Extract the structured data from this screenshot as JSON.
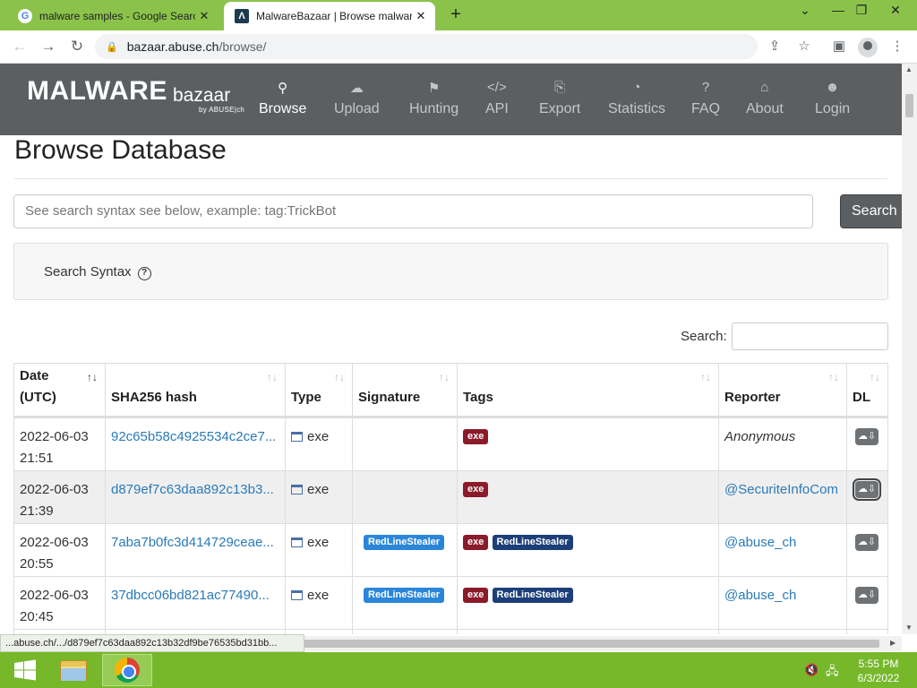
{
  "browser": {
    "tabs": [
      {
        "title": "malware samples - Google Search",
        "favicon": "G",
        "active": false
      },
      {
        "title": "MalwareBazaar | Browse malware",
        "favicon": "Λ",
        "active": true
      }
    ],
    "new_tab": "+",
    "address": {
      "host": "bazaar.abuse.ch",
      "path": "/browse/"
    }
  },
  "site": {
    "logo_main": "MALWARE",
    "logo_sub": "bazaar",
    "logo_by": "by ABUSE|ch",
    "nav": [
      {
        "label": "Browse",
        "icon": "search-icon"
      },
      {
        "label": "Upload",
        "icon": "cloud-upload-icon"
      },
      {
        "label": "Hunting",
        "icon": "hunting-icon"
      },
      {
        "label": "API",
        "icon": "code-icon"
      },
      {
        "label": "Export",
        "icon": "export-icon"
      },
      {
        "label": "Statistics",
        "icon": "pie-chart-icon"
      },
      {
        "label": "FAQ",
        "icon": "question-icon"
      },
      {
        "label": "About",
        "icon": "building-icon"
      },
      {
        "label": "Login",
        "icon": "user-icon"
      }
    ]
  },
  "page": {
    "title": "Browse Database",
    "search_placeholder": "See search syntax see below, example: tag:TrickBot",
    "search_button": "Search",
    "syntax_label": "Search Syntax",
    "filter_label": "Search:"
  },
  "table": {
    "headers": [
      "Date (UTC)",
      "SHA256 hash",
      "Type",
      "Signature",
      "Tags",
      "Reporter",
      "DL"
    ],
    "rows": [
      {
        "date": "2022-06-03",
        "time": "21:51",
        "hash": "92c65b58c4925534c2ce7...",
        "type": "exe",
        "signature": "",
        "tags": [
          "exe"
        ],
        "reporter": "Anonymous"
      },
      {
        "date": "2022-06-03",
        "time": "21:39",
        "hash": "d879ef7c63daa892c13b3...",
        "type": "exe",
        "signature": "",
        "tags": [
          "exe"
        ],
        "reporter": "@SecuriteInfoCom"
      },
      {
        "date": "2022-06-03",
        "time": "20:55",
        "hash": "7aba7b0fc3d414729ceae...",
        "type": "exe",
        "signature": "RedLineStealer",
        "tags": [
          "exe",
          "RedLineStealer"
        ],
        "reporter": "@abuse_ch"
      },
      {
        "date": "2022-06-03",
        "time": "20:45",
        "hash": "37dbcc06bd821ac77490...",
        "type": "exe",
        "signature": "RedLineStealer",
        "tags": [
          "exe",
          "RedLineStealer"
        ],
        "reporter": "@abuse_ch"
      }
    ]
  },
  "status_url": "...abuse.ch/.../d879ef7c63daa892c13b32df9be76535bd31bb...",
  "taskbar": {
    "time": "5:55 PM",
    "date": "6/3/2022"
  },
  "colors": {
    "tabbar": "#8bc34a",
    "sitenav": "#5b5f62",
    "link": "#2a7ab8",
    "tag_exe": "#8b1a2b",
    "tag_family": "#1c3f7a",
    "signature": "#2a86d9",
    "taskbar": "#76b82a"
  }
}
